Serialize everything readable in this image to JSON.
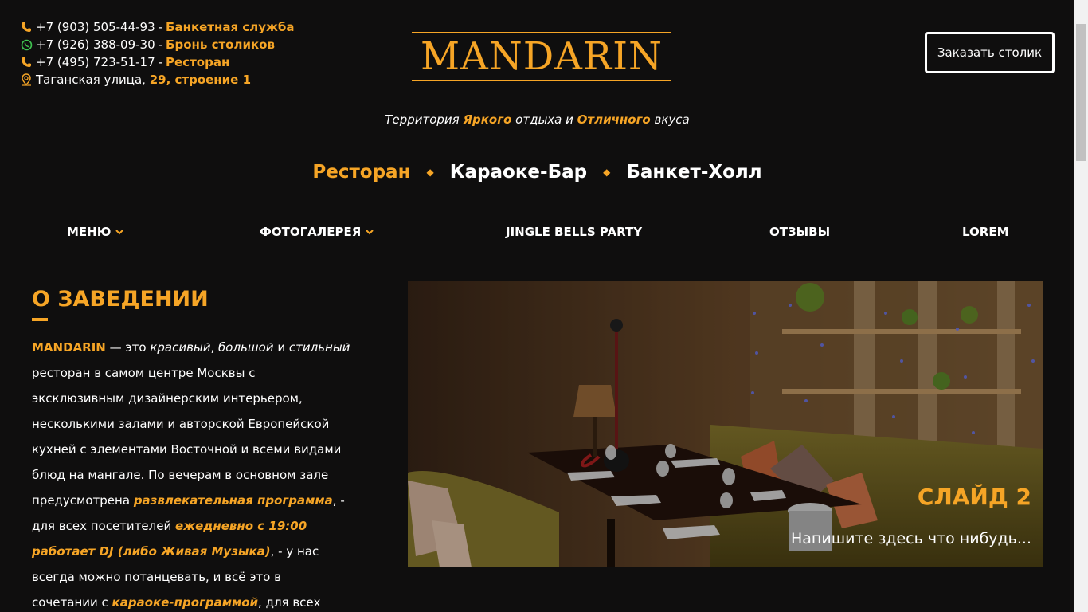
{
  "contacts": [
    {
      "icon": "phone-icon",
      "phone": "+7 (903) 505-44-93",
      "label": "Банкетная служба"
    },
    {
      "icon": "whatsapp-icon",
      "phone": "+7 (926) 388-09-30",
      "label": "Бронь столиков"
    },
    {
      "icon": "phone-icon",
      "phone": "+7 (495) 723-51-17",
      "label": "Ресторан"
    }
  ],
  "address": {
    "icon": "map-pin-icon",
    "street": "Таганская улица,",
    "building": "29, строение 1"
  },
  "logo": {
    "text": "MANDARIN"
  },
  "reserve_button": "Заказать столик",
  "tagline": {
    "p1": "Территория ",
    "h1": "Яркого",
    "p2": " отдыха и ",
    "h2": "Отличного",
    "p3": " вкуса"
  },
  "sections": [
    "Ресторан",
    "Караоке-Бар",
    "Банкет-Холл"
  ],
  "nav": [
    {
      "label": "МЕНЮ",
      "dropdown": true
    },
    {
      "label": "ФОТОГАЛЕРЕЯ",
      "dropdown": true
    },
    {
      "label": "JINGLE BELLS PARTY",
      "dropdown": false
    },
    {
      "label": "ОТЗЫВЫ",
      "dropdown": false
    },
    {
      "label": "LOREM",
      "dropdown": false
    }
  ],
  "about": {
    "title": "О ЗАВЕДЕНИИ",
    "brand": "MANDARIN",
    "t1": " — это ",
    "e1": "красивый",
    "t2": ", ",
    "e2": "большой",
    "t3": " и ",
    "e3": "стильный",
    "t4": " ресторан в самом центре Москвы с эксклюзивным дизайнерским интерьером, несколькими залами и авторской Европейской кухней с элементами Восточной и всеми видами блюд на мангале. По вечерам в основном зале предусмотрена ",
    "h1": "развлекательная программа",
    "t5": ", - для всех посетителей ",
    "h2": "ежедневно с 19:00 работает DJ (либо Живая Музыка)",
    "t6": ", - у нас всегда можно потанцевать, и всё это в сочетании с ",
    "h3": "караоке-программой",
    "t7": ", для всех желающих. В"
  },
  "slider": {
    "title": "СЛАЙД 2",
    "caption": "Напишите здесь что нибудь..."
  },
  "colors": {
    "accent": "#f6a526",
    "background": "#0f0e0e",
    "text": "#ffffff"
  }
}
